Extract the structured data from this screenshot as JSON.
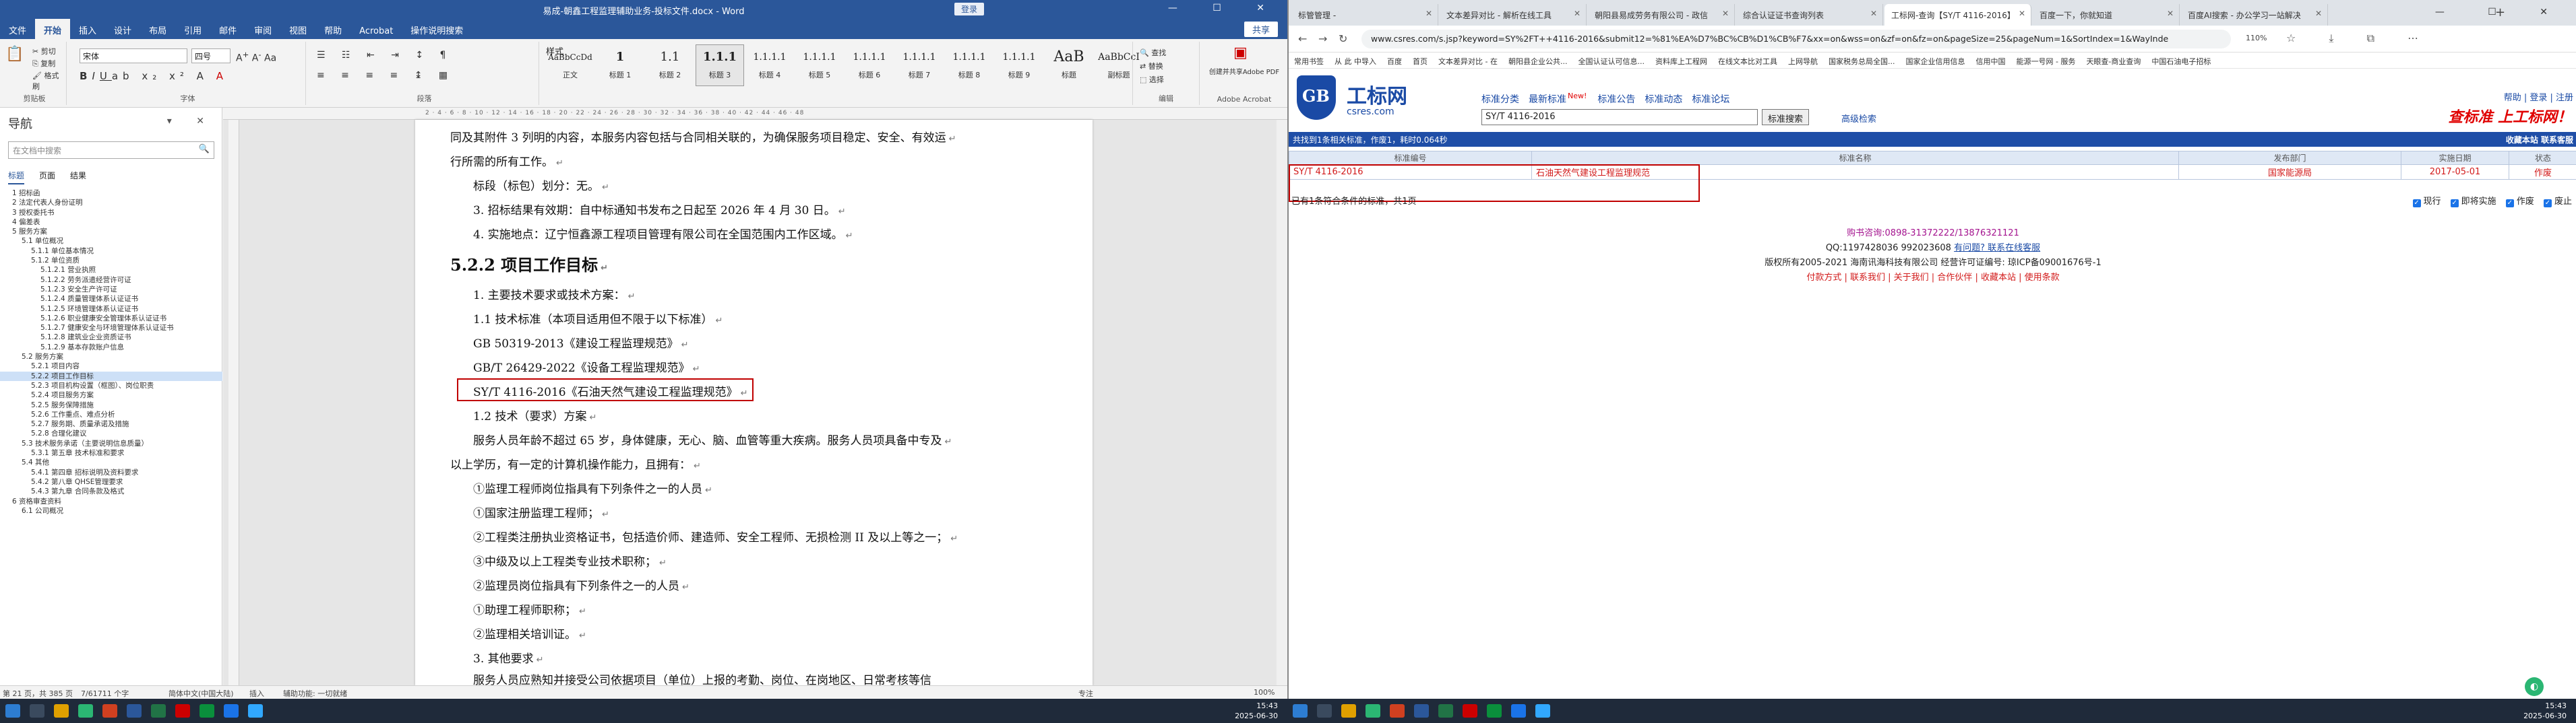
{
  "word": {
    "title": "易成-朝鑫工程监理辅助业务-投标文件.docx - Word",
    "login_label": "登录",
    "tabs": [
      "文件",
      "开始",
      "插入",
      "设计",
      "布局",
      "引用",
      "邮件",
      "审阅",
      "视图",
      "帮助",
      "Acrobat",
      "操作说明搜索"
    ],
    "share_label": "共享",
    "ribbon": {
      "clipboard": {
        "cut": "剪切",
        "copy": "复制",
        "painter": "格式刷",
        "label": "剪贴板"
      },
      "font_name": "宋体",
      "font_size": "四号",
      "font_label": "字体",
      "paragraph_label": "段落",
      "styles_label": "样式",
      "styles": [
        {
          "preview": "AaBbCcDd",
          "name": "正文"
        },
        {
          "preview": "1",
          "name": "标题 1"
        },
        {
          "preview": "1.1",
          "name": "标题 2"
        },
        {
          "preview": "1.1.1",
          "name": "标题 3"
        },
        {
          "preview": "1.1.1.1",
          "name": "标题 4"
        },
        {
          "preview": "1.1.1.1",
          "name": "标题 5"
        },
        {
          "preview": "1.1.1.1",
          "name": "标题 6"
        },
        {
          "preview": "1.1.1.1",
          "name": "标题 7"
        },
        {
          "preview": "1.1.1.1",
          "name": "标题 8"
        },
        {
          "preview": "1.1.1.1",
          "name": "标题 9"
        },
        {
          "preview": "AaB",
          "name": "标题"
        },
        {
          "preview": "AaBbCcI",
          "name": "副标题"
        }
      ],
      "editing": {
        "find": "查找",
        "replace": "替换",
        "select": "选择",
        "label": "编辑"
      },
      "acrobat": {
        "btn": "创建并共享Adobe PDF",
        "label": "Adobe Acrobat"
      }
    },
    "nav": {
      "title": "导航",
      "search_placeholder": "在文档中搜索",
      "tabs": [
        "标题",
        "页面",
        "结果"
      ],
      "items": [
        "1 招标函",
        "2 法定代表人身份证明",
        "3 授权委托书",
        "4 偏差表",
        "5 服务方案",
        "5.1 单位概况",
        "5.1.1 单位基本情况",
        "5.1.2 单位资质",
        "5.1.2.1 营业执照",
        "5.1.2.2 劳务派遣经营许可证",
        "5.1.2.3 安全生产许可证",
        "5.1.2.4 质量管理体系认证证书",
        "5.1.2.5 环境管理体系认证证书",
        "5.1.2.6 职业健康安全管理体系认证证书",
        "5.1.2.7 健康安全与环境管理体系认证证书",
        "5.1.2.8 建筑业企业资质证书",
        "5.1.2.9 基本存款账户信息",
        "5.2 服务方案",
        "5.2.1 项目内容",
        "5.2.2 项目工作目标",
        "5.2.3 项目机构设置（框图）、岗位职责",
        "5.2.4 项目服务方案",
        "5.2.5 服务保障措施",
        "5.2.6 工作重点、难点分析",
        "5.2.7 服务期、质量承诺及措施",
        "5.2.8 合理化建议",
        "5.3 技术服务承诺（主要说明信息质量）",
        "5.3.1 第五章 技术标准和要求",
        "5.4 其他",
        "5.4.1 第四章 招标说明及资料要求",
        "5.4.2 第八章 QHSE管理要求",
        "5.4.3 第九章 合同条款及格式",
        "6 资格审查资料",
        "6.1 公司概况"
      ],
      "selected_index": 19
    },
    "doc_lines": [
      "同及其附件 3 列明的内容，本服务内容包括与合同相关联的，为确保服务项目稳定、安全、有效运",
      "行所需的所有工作。",
      "标段（标包）划分：无。",
      "3. 招标结果有效期：自中标通知书发布之日起至 2026 年 4 月 30 日。",
      "4. 实施地点：辽宁恒鑫源工程项目管理有限公司在全国范围内工作区域。",
      "5.2.2 项目工作目标",
      "1. 主要技术要求或技术方案：",
      "1.1 技术标准（本项目适用但不限于以下标准）",
      "GB 50319-2013《建设工程监理规范》",
      "GB/T  26429-2022《设备工程监理规范》",
      "SY/T  4116-2016《石油天然气建设工程监理规范》",
      "1.2 技术（要求）方案",
      "服务人员年龄不超过 65 岁，身体健康，无心、脑、血管等重大疾病。服务人员项具备中专及",
      "以上学历，有一定的计算机操作能力，且拥有：",
      "①监理工程师岗位指具有下列条件之一的人员",
      "①国家注册监理工程师；",
      "②工程类注册执业资格证书，包括造价师、建造师、安全工程师、无损检测 II 及以上等之一；",
      "③中级及以上工程类专业技术职称；",
      "②监理员岗位指具有下列条件之一的人员",
      "①助理工程师职称；",
      "②监理相关培训证。",
      "3. 其他要求",
      "服务人员应熟知并接受公司依据项目（单位）上报的考勤、岗位、在岗地区、日常考核等信"
    ],
    "ruler_marks": "2 · 4 · 6 · 8 · 10 · 12 · 14 · 16 · 18 · 20 · 22 · 24 · 26 · 28 · 30 · 32 · 34 · 36 · 38 · 40 · 42 · 44 · 46 · 48",
    "status": {
      "page": "第 21 页，共 385 页",
      "words": "7/61711 个字",
      "lang": "简体中文(中国大陆)",
      "mode": "插入",
      "accessibility": "辅助功能: 一切就绪",
      "focus": "专注",
      "zoom": "100%"
    }
  },
  "browser": {
    "tabs": [
      "标管管理 - ",
      "文本差异对比 - 解析在线工具",
      "朝阳县易成劳务有限公司 - 政信",
      "综合认证证书查询列表",
      "工标网-查询【SY/T 4116-2016】",
      "百度一下，你就知道",
      "百度AI搜索 - 办公学习一站解决"
    ],
    "active_tab": 4,
    "url": "www.csres.com/s.jsp?keyword=SY%2FT++4116-2016&submit12=%81%EA%D7%BC%CB%D1%CB%F7&xx=on&wss=on&zf=on&fz=on&pageSize=25&pageNum=1&SortIndex=1&WayInde",
    "zoom": "110%",
    "bookmarks": [
      "常用书签",
      "从 此 中导入",
      "百度",
      "首页",
      "文本差异对比 - 在",
      "朝阳县企业公共...",
      "全国认证认可信息...",
      "资料库上工程网",
      "在线文本比对工具",
      "上网导航",
      "国家税务总局全国...",
      "国家企业信用信息",
      "信用中国",
      "能源一号网 - 服务",
      "天眼查-商业查询",
      "中国石油电子招标"
    ],
    "site": {
      "logo_text": "GB",
      "name": "工标网",
      "domain": "csres.com",
      "menu": [
        "标准分类",
        "最新标准",
        "标准公告",
        "标准动态",
        "标准论坛"
      ],
      "new_badge": "New!",
      "search_value": "SY/T  4116-2016",
      "search_button": "标准搜索",
      "advanced_search": "高级检索",
      "links": "帮助 | 登录 | 注册",
      "slogan": "查标准 上工标网！"
    },
    "result_summary": "共找到1条相关标准，作废1，耗时0.064秒",
    "result_right": "收藏本站  联系客服",
    "table": {
      "headers": [
        "标准编号",
        "标准名称",
        "发布部门",
        "实施日期",
        "状态"
      ],
      "rows": [
        {
          "code": "SY/T 4116-2016",
          "name": "石油天然气建设工程监理规范",
          "dept": "国家能源局",
          "date": "2017-05-01",
          "status": "作废"
        }
      ]
    },
    "no_more": "已有1条符合条件的标准，共1页",
    "filters": [
      "现行",
      "即将实施",
      "作废",
      "废止"
    ],
    "footer": {
      "buy": "购书咨询:0898-31372222/13876321121",
      "qq": "QQ:1197428036 992023608",
      "qq_links": "有问题? 联系在线客服",
      "copyright": "版权所有2005-2021 海南讯海科技有限公司 经营许可证编号: 琼ICP备09001676号-1",
      "links": "付款方式 | 联系我们 | 关于我们 | 合作伙伴 | 收藏本站 | 使用条款"
    }
  },
  "taskbar": {
    "time": "15:43",
    "date": "2025-06-30"
  }
}
